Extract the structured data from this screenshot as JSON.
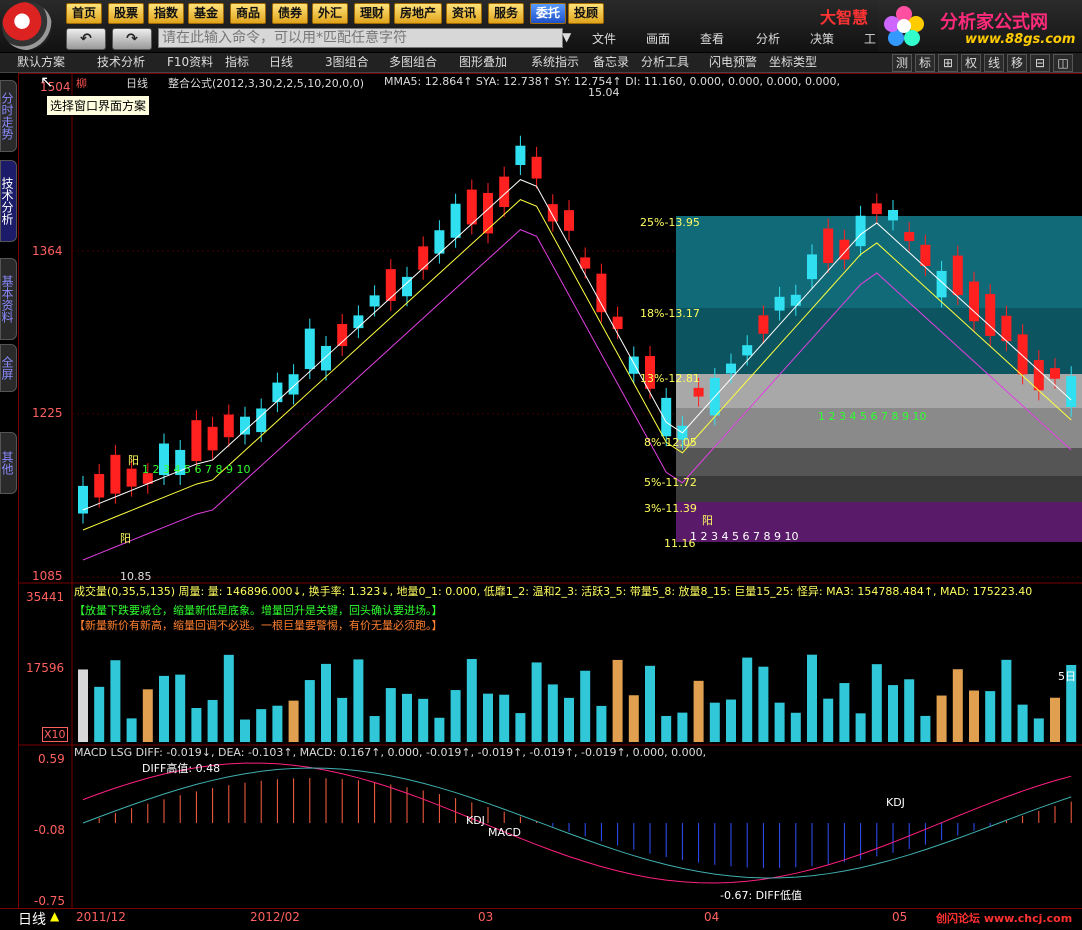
{
  "menu": [
    "首页",
    "股票",
    "指数",
    "基金",
    "商品",
    "债券",
    "外汇",
    "理财",
    "房地产",
    "资讯",
    "服务",
    "委托",
    "投顾"
  ],
  "menu_active": "委托",
  "command_placeholder": "请在此输入命令，可以用*匹配任意字符",
  "submenu": [
    "文件",
    "画面",
    "查看",
    "分析",
    "决策",
    "工"
  ],
  "brand": {
    "name": "大智慧",
    "site": "分析家公式网",
    "url": "www.88gs.com"
  },
  "toolbar": {
    "items": [
      "默认方案",
      "技术分析",
      "F10资料",
      "指标",
      "日线",
      "3图组合",
      "多图组合",
      "图形叠加",
      "系统指示",
      "备忘录",
      "分析工具",
      "闪电预警",
      "坐标类型"
    ],
    "right_buttons": [
      "测",
      "标",
      "⊞",
      "权",
      "线",
      "移",
      "⊟",
      "◫"
    ]
  },
  "tooltip": "选择窗口界面方案",
  "side_tabs": [
    "分时走势",
    "技术分析",
    "基本资料",
    "全屏",
    "其他"
  ],
  "main_chart": {
    "code_label": "柳",
    "period": "日线",
    "formula": "整合公式(2012,3,30,2,2,5,10,20,0,0)",
    "ma_text": "MMA5: 12.864↑ SYA: 12.738↑ SY: 12.754↑ DI: 11.160, 0.000, 0.000, 0.000, 0.000,",
    "y_ticks": [
      "1364",
      "1225",
      "1085"
    ],
    "top_tick": "1504",
    "high_label": "15.04",
    "low_label": "10.85",
    "low_label2": "11.16",
    "fib_labels": [
      "25%-13.95",
      "18%-13.17",
      "13%-12.81",
      "8%-12.05",
      "5%-11.72",
      "3%-11.39"
    ],
    "yang": "阳",
    "count_seq": "1 2 3 4 5 6 7 8 9 10"
  },
  "volume_chart": {
    "header": "成交量(0,35,5,135)  周量: 量: 146896.000↓, 换手率: 1.323↓, 地量0_1: 0.000, 低靡1_2: 温和2_3: 活跃3_5: 带量5_8: 放量8_15: 巨量15_25: 怪异: MA3: 154788.484↑, MAD: 175223.40",
    "note1": "【放量下跌要减仓，缩量新低是底象。增量回升是关键，回头确认要进场。】",
    "note2": "【新量新价有新高，缩量回调不必逃。一根巨量要警惕，有价无量必须跑。】",
    "y_ticks": [
      "35441",
      "17596"
    ],
    "x10": "X10",
    "day5": "5日"
  },
  "macd_chart": {
    "header": "MACD LSG  DIFF: -0.019↓, DEA: -0.103↑, MACD: 0.167↑, 0.000, -0.019↑, -0.019↑, -0.019↑, -0.019↑, 0.000, 0.000,",
    "diff_high": "DIFF高值: 0.48",
    "diff_low": "-0.67: DIFF低值",
    "kdj": "KDJ",
    "macd": "MACD",
    "y_ticks": [
      "0.59",
      "-0.08",
      "-0.75"
    ]
  },
  "bottom": {
    "period_label": "日线",
    "dates": [
      "2011/12",
      "2012/02",
      "03",
      "04",
      "05"
    ],
    "credit": "创闪论坛 www.chcj.com"
  },
  "colors": {
    "up": "#ff2020",
    "down": "#30e0f0",
    "bg": "#000000",
    "frame": "#7a0000",
    "yellow": "#ffff00",
    "magenta": "#ff40ff"
  }
}
